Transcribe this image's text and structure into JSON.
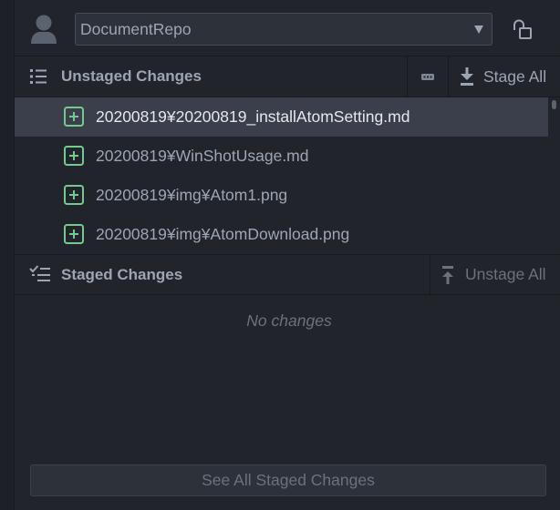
{
  "header": {
    "avatar_icon": "person-icon",
    "repo_select": {
      "value": "DocumentRepo",
      "arrow_icon": "chevron-down-icon"
    },
    "lock_icon": "unlock-icon"
  },
  "unstaged": {
    "icon": "list-unordered-icon",
    "title": "Unstaged Changes",
    "options_icon": "ellipsis-icon",
    "stage_all_icon": "move-down-icon",
    "stage_all_label": "Stage All",
    "files": [
      {
        "icon": "diff-added-icon",
        "path": "20200819¥20200819_installAtomSetting.md",
        "selected": true
      },
      {
        "icon": "diff-added-icon",
        "path": "20200819¥WinShotUsage.md",
        "selected": false
      },
      {
        "icon": "diff-added-icon",
        "path": "20200819¥img¥Atom1.png",
        "selected": false
      },
      {
        "icon": "diff-added-icon",
        "path": "20200819¥img¥AtomDownload.png",
        "selected": false
      }
    ]
  },
  "staged": {
    "icon": "tasklist-icon",
    "title": "Staged Changes",
    "unstage_all_icon": "move-up-icon",
    "unstage_all_label": "Unstage All",
    "files": [],
    "empty_text": "No changes"
  },
  "footer": {
    "see_all_label": "See All Staged Changes"
  },
  "colors": {
    "background": "#21252b",
    "border": "#181a1f",
    "text": "#9da5b4",
    "text_selected": "#e6e8ec",
    "text_muted": "#6b717d",
    "selected_row": "#3a3f4b",
    "added_green": "#73c990",
    "control_bg": "#2c313a"
  }
}
